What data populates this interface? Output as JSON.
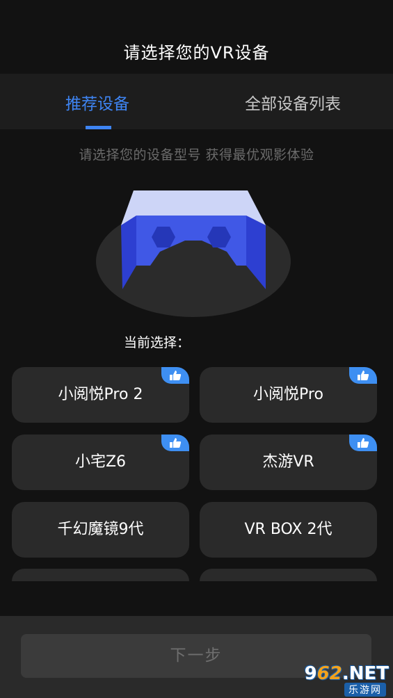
{
  "header": {
    "title": "请选择您的VR设备"
  },
  "tabs": [
    {
      "label": "推荐设备",
      "active": true
    },
    {
      "label": "全部设备列表",
      "active": false
    }
  ],
  "subtitle": "请选择您的设备型号  获得最优观影体验",
  "current_selection_label": "当前选择：",
  "devices": [
    {
      "name": "小阅悦Pro 2",
      "recommended": true
    },
    {
      "name": "小阅悦Pro",
      "recommended": true
    },
    {
      "name": "小宅Z6",
      "recommended": true
    },
    {
      "name": "杰游VR",
      "recommended": true
    },
    {
      "name": "千幻魔镜9代",
      "recommended": false
    },
    {
      "name": "VR BOX 2代",
      "recommended": false
    },
    {
      "name": "",
      "recommended": false
    },
    {
      "name": "",
      "recommended": false
    }
  ],
  "next_button": {
    "label": "下一步",
    "enabled": false
  },
  "watermark": {
    "main_prefix": "9",
    "main_num": "62",
    "main_suffix": ".NET",
    "sub": "乐游网"
  },
  "colors": {
    "accent": "#3e84f2",
    "background": "#121212",
    "card": "#2a2a2a",
    "badge": "#3e8ff2"
  },
  "icons": {
    "badge_icon": "thumbs-up-icon"
  }
}
